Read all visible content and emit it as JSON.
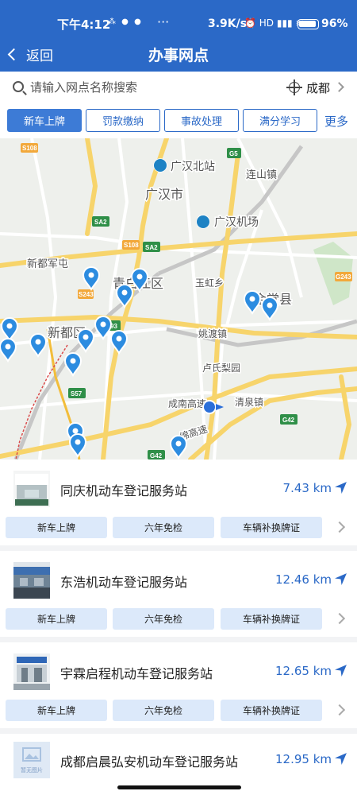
{
  "status_bar": {
    "time": "下午4:12",
    "dots": "⁂ ● ●",
    "more": "···",
    "speed": "3.9K/s",
    "icons": "⏰ HD ▮▮▮ ≋",
    "battery_level": 0.96,
    "battery_text": "96%"
  },
  "nav": {
    "back_label": "返回",
    "title": "办事网点"
  },
  "search": {
    "placeholder": "请输入网点名称搜索",
    "city": "成都"
  },
  "tabs": [
    {
      "label": "新车上牌",
      "active": true
    },
    {
      "label": "罚款缴纳",
      "active": false
    },
    {
      "label": "事故处理",
      "active": false
    },
    {
      "label": "满分学习",
      "active": false
    }
  ],
  "more_tab": "更多",
  "map": {
    "labels": {
      "guanghan_north": "广汉北站",
      "guanghan_city": "广汉市",
      "guanghan_airport": "广汉机场",
      "lianshan": "连山镇",
      "xindu_juntun": "新都军屯",
      "qingbaijiang": "青白江区",
      "yuhongxiang": "玉虹乡",
      "jintang": "金堂县",
      "xindu": "新都区",
      "yaodu": "姚渡镇",
      "lushi": "卢氏梨园",
      "chengnan": "成南高速",
      "qingquan": "清泉镇",
      "expressway": "绵高速"
    },
    "road_badges": {
      "s108": "S108",
      "g5": "G5",
      "sa2_a": "SA2",
      "s108b": "S108",
      "sa2_b": "SA2",
      "s243": "S243",
      "g243": "G243",
      "s93": "93",
      "s57": "S57",
      "g42": "G42",
      "g42b": "G42"
    }
  },
  "stations": [
    {
      "name": "同庆机动车登记服务站",
      "distance": "7.43 km",
      "services": [
        "新车上牌",
        "六年免检",
        "车辆补换牌证"
      ]
    },
    {
      "name": "东浩机动车登记服务站",
      "distance": "12.46 km",
      "services": [
        "新车上牌",
        "六年免检",
        "车辆补换牌证"
      ]
    },
    {
      "name": "宇霖启程机动车登记服务站",
      "distance": "12.65 km",
      "services": [
        "新车上牌",
        "六年免检",
        "车辆补换牌证"
      ]
    },
    {
      "name": "成都启晨弘安机动车登记服务站",
      "distance": "12.95 km",
      "no_image_text": "暂无图片",
      "services": []
    }
  ]
}
